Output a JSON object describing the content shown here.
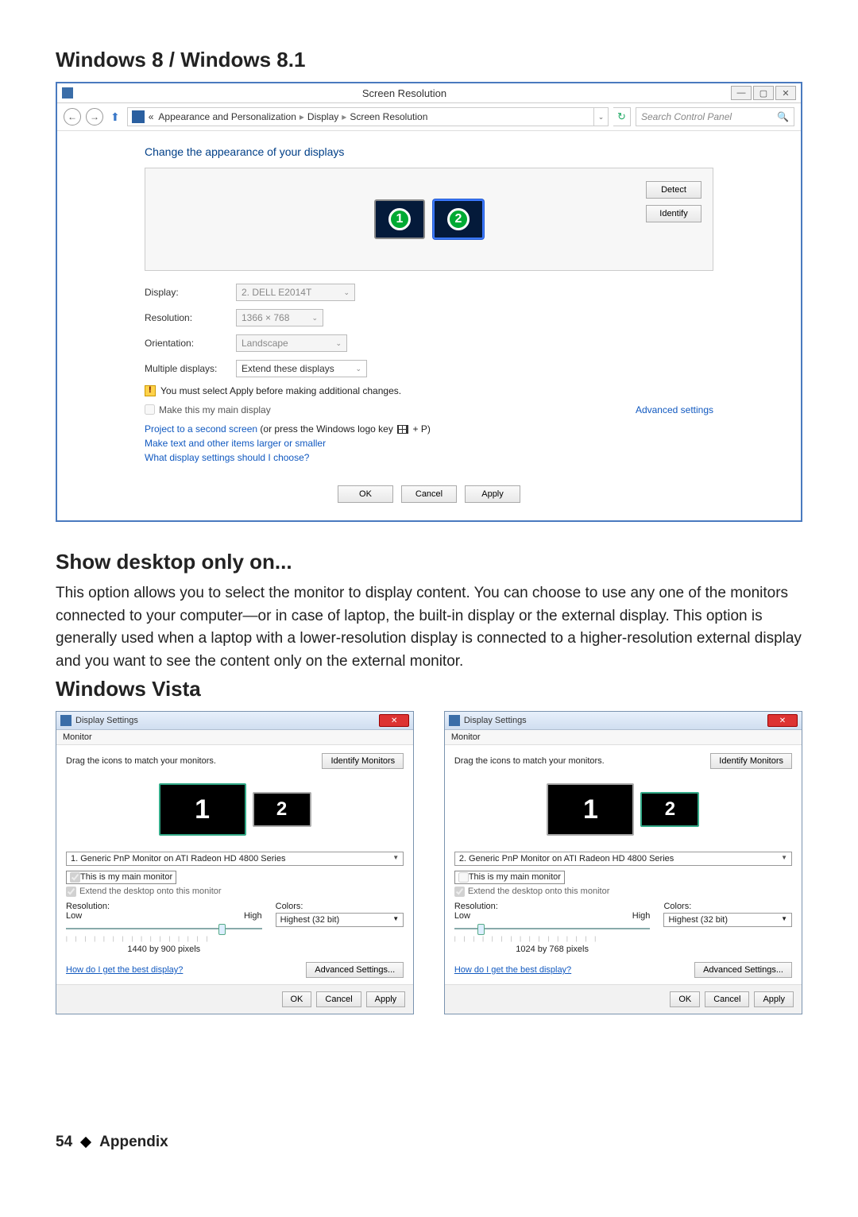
{
  "section1_title": "Windows 8 / Windows 8.1",
  "win8": {
    "window_title": "Screen Resolution",
    "breadcrumb": {
      "root": "«",
      "l1": "Appearance and Personalization",
      "l2": "Display",
      "l3": "Screen Resolution"
    },
    "search_placeholder": "Search Control Panel",
    "heading": "Change the appearance of your displays",
    "monitors": {
      "m1": "1",
      "m2": "2"
    },
    "detect": "Detect",
    "identify": "Identify",
    "labels": {
      "display": "Display:",
      "resolution": "Resolution:",
      "orientation": "Orientation:",
      "multi": "Multiple displays:"
    },
    "values": {
      "display": "2. DELL E2014T",
      "resolution": "1366 × 768",
      "orientation": "Landscape",
      "multi": "Extend these displays"
    },
    "warning": "You must select Apply before making additional changes.",
    "checkbox": "Make this my main display",
    "advanced": "Advanced settings",
    "project_line_a": "Project to a second screen",
    "project_line_b": " (or press the Windows logo key ",
    "project_line_c": " + P)",
    "link1": "Make text and other items larger or smaller",
    "link2": "What display settings should I choose?",
    "ok": "OK",
    "cancel": "Cancel",
    "apply": "Apply",
    "winbtns": {
      "min": "—",
      "max": "▢",
      "close": "✕"
    }
  },
  "section2_title": "Show desktop only on...",
  "section2_body": "This option allows you to select the monitor to display content. You can choose to use any one of the monitors connected to your computer—or in case of laptop, the built-in display or the external display. This option is generally used when a laptop with a lower-resolution display is connected to a higher-resolution external display and you want to see the content only on the external monitor.",
  "section3_title": "Windows Vista",
  "vista_common": {
    "title": "Display Settings",
    "menu": "Monitor",
    "drag_text": "Drag the icons to match your monitors.",
    "identify": "Identify Monitors",
    "chk_main": "This is my main monitor",
    "chk_extend": "Extend the desktop onto this monitor",
    "res_label": "Resolution:",
    "colors_label": "Colors:",
    "low": "Low",
    "high": "High",
    "color_value": "Highest (32 bit)",
    "help_link": "How do I get the best display?",
    "adv": "Advanced Settings...",
    "ok": "OK",
    "cancel": "Cancel",
    "apply": "Apply"
  },
  "vista_left": {
    "monitor_dd": "1. Generic PnP Monitor on ATI Radeon HD 4800 Series",
    "res_caption": "1440 by 900 pixels",
    "thumb_pct": 78
  },
  "vista_right": {
    "monitor_dd": "2. Generic PnP Monitor on ATI Radeon HD 4800 Series",
    "res_caption": "1024 by 768 pixels",
    "thumb_pct": 12
  },
  "footer": {
    "page": "54",
    "section": "Appendix"
  }
}
